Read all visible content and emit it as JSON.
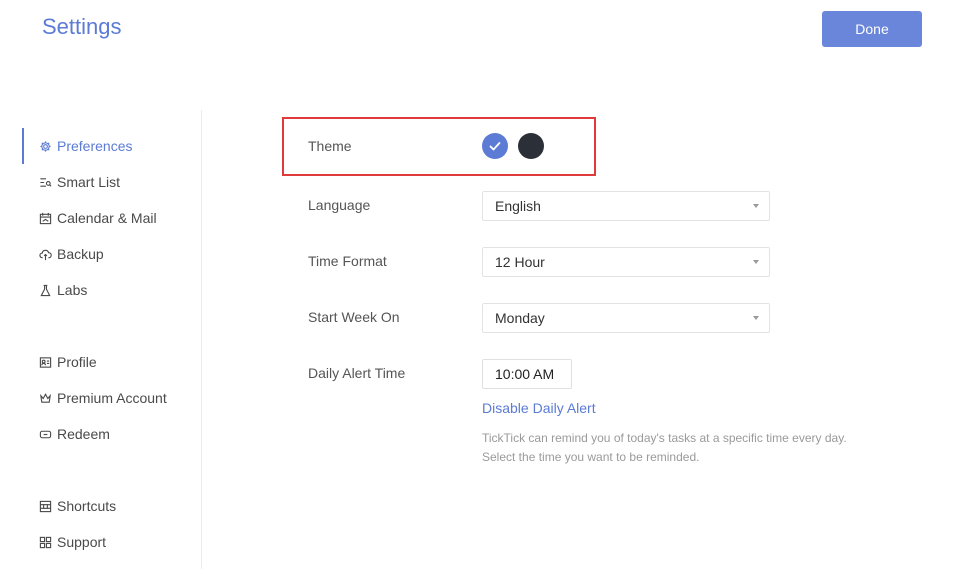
{
  "header": {
    "title": "Settings",
    "done_label": "Done",
    "accent_color": "#5b7bd5"
  },
  "sidebar": {
    "items": [
      {
        "label": "Preferences",
        "icon": "gear-icon",
        "active": true
      },
      {
        "label": "Smart List",
        "icon": "smart-list-icon"
      },
      {
        "label": "Calendar & Mail",
        "icon": "calendar-icon"
      },
      {
        "label": "Backup",
        "icon": "cloud-icon"
      },
      {
        "label": "Labs",
        "icon": "flask-icon"
      },
      {
        "label": "Profile",
        "icon": "profile-card-icon"
      },
      {
        "label": "Premium Account",
        "icon": "crown-icon"
      },
      {
        "label": "Redeem",
        "icon": "ticket-icon"
      },
      {
        "label": "Shortcuts",
        "icon": "command-icon"
      },
      {
        "label": "Support",
        "icon": "grid-icon"
      }
    ]
  },
  "preferences": {
    "theme_label": "Theme",
    "themes": [
      {
        "name": "blue",
        "color": "#5b7bd5",
        "selected": true
      },
      {
        "name": "dark",
        "color": "#2b2f38",
        "selected": false
      }
    ],
    "language_label": "Language",
    "language_value": "English",
    "time_format_label": "Time Format",
    "time_format_value": "12 Hour",
    "start_week_label": "Start Week On",
    "start_week_value": "Monday",
    "daily_alert_label": "Daily Alert Time",
    "daily_alert_value": "10:00 AM",
    "disable_alert_label": "Disable Daily Alert",
    "hint_text": "TickTick can remind you of today's tasks at a specific time every day. Select the time you want to be reminded."
  }
}
